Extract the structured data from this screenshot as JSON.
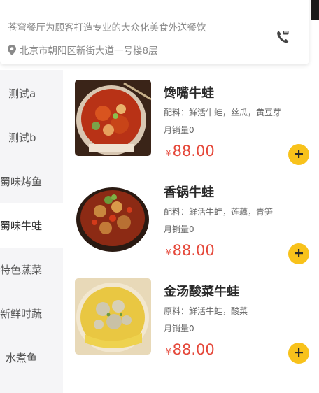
{
  "shop": {
    "description": "苍穹餐厅为顾客打造专业的大众化美食外送餐饮",
    "address": "北京市朝阳区新街大道一号楼8层"
  },
  "sidebar": {
    "items": [
      {
        "label": "测试a"
      },
      {
        "label": "测试b"
      },
      {
        "label": "蜀味烤鱼"
      },
      {
        "label": "蜀味牛蛙"
      },
      {
        "label": "特色蒸菜"
      },
      {
        "label": "新鲜时蔬"
      },
      {
        "label": "水煮鱼"
      }
    ],
    "active_index": 3
  },
  "dishes": [
    {
      "name": "馋嘴牛蛙",
      "ingredients": "配料：鲜活牛蛙，丝瓜，黄豆芽",
      "sales": "月销量0",
      "currency": "¥",
      "price": "88.00"
    },
    {
      "name": "香锅牛蛙",
      "ingredients": "配料：鲜活牛蛙，莲藕，青笋",
      "sales": "月销量0",
      "currency": "¥",
      "price": "88.00"
    },
    {
      "name": "金汤酸菜牛蛙",
      "ingredients": "原料：鲜活牛蛙，酸菜",
      "sales": "月销量0",
      "currency": "¥",
      "price": "88.00"
    }
  ],
  "colors": {
    "accent": "#f8c21b",
    "price": "#e5483a",
    "sidebar_bg": "#f5f5f7"
  },
  "icons": [
    "location-pin-icon",
    "phone-icon",
    "plus-icon"
  ]
}
